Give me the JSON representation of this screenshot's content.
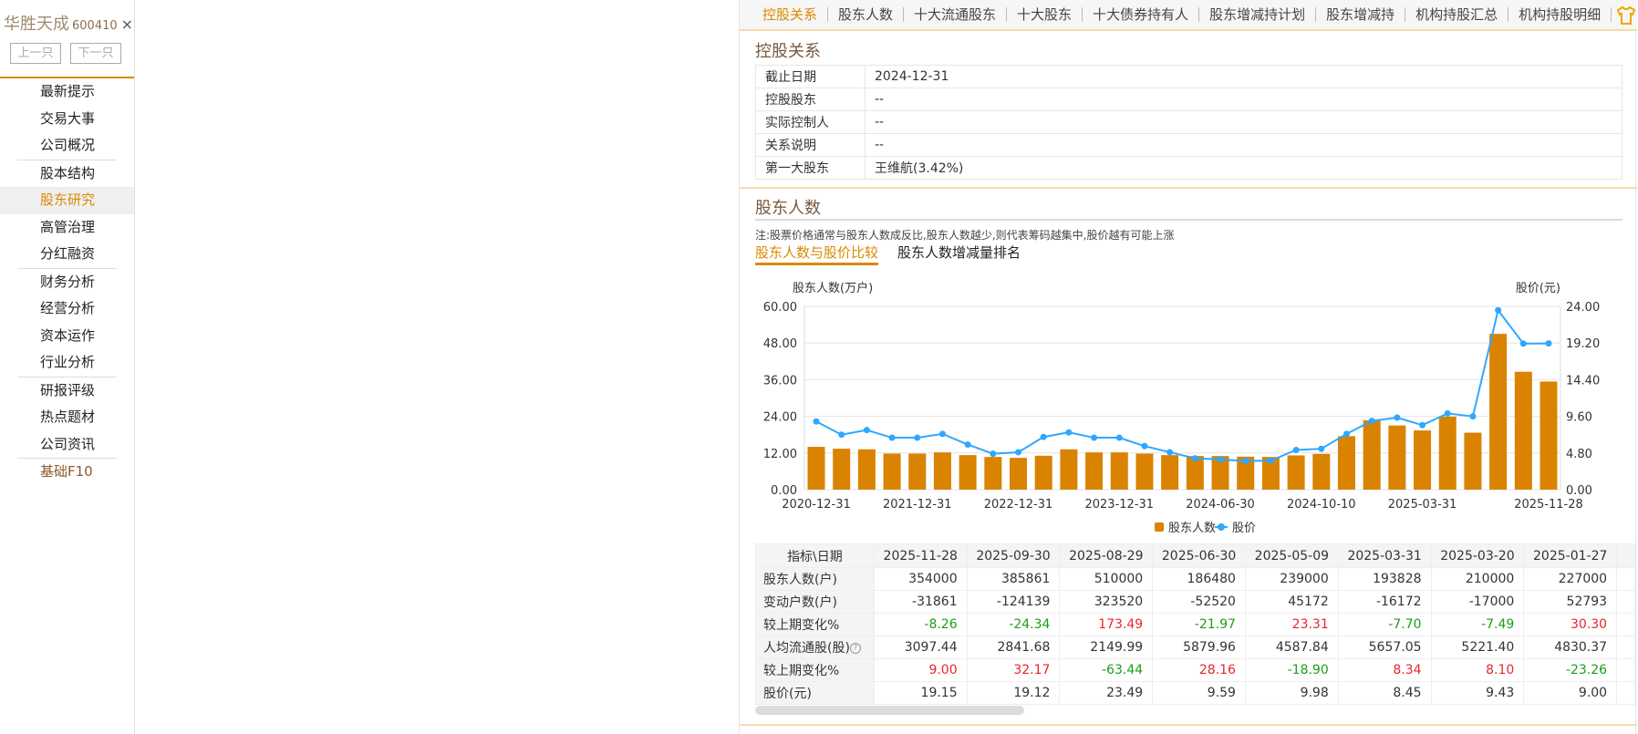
{
  "sidebar": {
    "stock_name": "华胜天成",
    "stock_code": "600410",
    "close_icon": "×",
    "prev_label": "上一只",
    "next_label": "下一只",
    "groups": [
      [
        "最新提示",
        "交易大事",
        "公司概况"
      ],
      [
        "股本结构",
        "股东研究",
        "高管治理",
        "分红融资"
      ],
      [
        "财务分析",
        "经营分析",
        "资本运作",
        "行业分析"
      ],
      [
        "研报评级",
        "热点题材",
        "公司资讯"
      ],
      [
        "基础F10"
      ]
    ],
    "active": "股东研究"
  },
  "tabs": [
    "控股关系",
    "股东人数",
    "十大流通股东",
    "十大股东",
    "十大债券持有人",
    "股东增减持计划",
    "股东增减持",
    "机构持股汇总",
    "机构持股明细"
  ],
  "control": {
    "title": "控股关系",
    "rows": [
      {
        "label": "截止日期",
        "value": "2024-12-31"
      },
      {
        "label": "控股股东",
        "value": "--"
      },
      {
        "label": "实际控制人",
        "value": "--"
      },
      {
        "label": "关系说明",
        "value": "--"
      },
      {
        "label": "第一大股东",
        "value": "王维航(3.42%)"
      }
    ]
  },
  "holders": {
    "title": "股东人数",
    "note": "注:股票价格通常与股东人数成反比,股东人数越少,则代表筹码越集中,股价越有可能上涨",
    "subtabs": [
      "股东人数与股价比较",
      "股东人数增减量排名"
    ]
  },
  "chart_data": {
    "type": "bar+line",
    "ylabel_left": "股东人数(万户)",
    "ylabel_right": "股价(元)",
    "yticks_left": [
      "60.00",
      "48.00",
      "36.00",
      "24.00",
      "12.00",
      "0.00"
    ],
    "yticks_right": [
      "24.00",
      "19.20",
      "14.40",
      "9.60",
      "4.80",
      "0.00"
    ],
    "ylim_left": [
      0,
      60
    ],
    "ylim_right": [
      0,
      24
    ],
    "xtick_labels": [
      {
        "i": 0,
        "label": "2020-12-31"
      },
      {
        "i": 4,
        "label": "2021-12-31"
      },
      {
        "i": 8,
        "label": "2022-12-31"
      },
      {
        "i": 12,
        "label": "2023-12-31"
      },
      {
        "i": 16,
        "label": "2024-06-30"
      },
      {
        "i": 20,
        "label": "2024-10-10"
      },
      {
        "i": 24,
        "label": "2025-03-31"
      },
      {
        "i": 29,
        "label": "2025-11-28"
      }
    ],
    "series": [
      {
        "name": "股东人数",
        "type": "bar",
        "color": "#d98300",
        "values": [
          14.0,
          13.4,
          13.2,
          11.8,
          11.8,
          12.2,
          11.3,
          10.7,
          10.4,
          11.1,
          13.2,
          12.2,
          12.2,
          11.8,
          11.3,
          11.0,
          11.0,
          10.8,
          10.7,
          11.2,
          11.7,
          17.5,
          22.7,
          21.0,
          19.38,
          23.9,
          18.65,
          51.0,
          38.59,
          35.4
        ]
      },
      {
        "name": "股价",
        "type": "line",
        "color": "#2ea7ff",
        "values": [
          8.93,
          7.2,
          7.8,
          6.8,
          6.8,
          7.3,
          5.9,
          4.7,
          4.9,
          6.9,
          7.5,
          6.8,
          6.8,
          5.7,
          4.9,
          4.1,
          3.95,
          3.75,
          3.8,
          5.2,
          5.35,
          7.3,
          9.0,
          9.43,
          8.45,
          9.98,
          9.59,
          23.49,
          19.12,
          19.15
        ]
      }
    ],
    "legend": "bottom-center"
  },
  "table": {
    "header": [
      "指标\\日期",
      "2025-11-28",
      "2025-09-30",
      "2025-08-29",
      "2025-06-30",
      "2025-05-09",
      "2025-03-31",
      "2025-03-20",
      "2025-01-27"
    ],
    "rows": [
      {
        "label": "股东人数(户)",
        "values": [
          "354000",
          "385861",
          "510000",
          "186480",
          "239000",
          "193828",
          "210000",
          "227000"
        ]
      },
      {
        "label": "变动户数(户)",
        "values": [
          "-31861",
          "-124139",
          "323520",
          "-52520",
          "45172",
          "-16172",
          "-17000",
          "52793"
        ]
      },
      {
        "label": "较上期变化%",
        "values": [
          "-8.26",
          "-24.34",
          "173.49",
          "-21.97",
          "23.31",
          "-7.70",
          "-7.49",
          "30.30"
        ],
        "colored": true
      },
      {
        "label": "人均流通股(股)",
        "values": [
          "3097.44",
          "2841.68",
          "2149.99",
          "5879.96",
          "4587.84",
          "5657.05",
          "5221.40",
          "4830.37"
        ],
        "help": "?"
      },
      {
        "label": "较上期变化%",
        "values": [
          "9.00",
          "32.17",
          "-63.44",
          "28.16",
          "-18.90",
          "8.34",
          "8.10",
          "-23.26"
        ],
        "colored": true
      },
      {
        "label": "股价(元)",
        "values": [
          "19.15",
          "19.12",
          "23.49",
          "9.59",
          "9.98",
          "8.45",
          "9.43",
          "9.00"
        ]
      }
    ]
  }
}
